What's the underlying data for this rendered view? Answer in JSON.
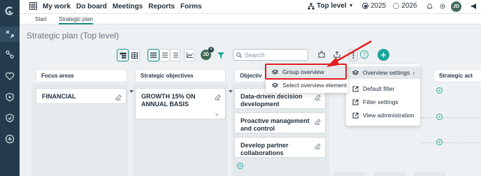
{
  "topnav": {
    "items": [
      "My work",
      "Do board",
      "Meetings",
      "Reports",
      "Forms"
    ],
    "level": "Top level",
    "years": [
      {
        "label": "2025",
        "selected": true
      },
      {
        "label": "2026",
        "selected": false
      }
    ],
    "avatar_initials": "JD"
  },
  "tabs": [
    "Start",
    "Strategic plan"
  ],
  "page": {
    "title": "Strategic plan (Top level)"
  },
  "toolbar": {
    "search_placeholder": "Search",
    "avatar_initials": "JD",
    "avatar_badge": "4",
    "help": "?",
    "add": "+"
  },
  "columns": {
    "focus_areas": "Focus areas",
    "strategic_objectives": "Strategic objectives",
    "objectives": "Objectiv",
    "strategic_act": "Strategic act"
  },
  "cards": {
    "focus": "FINANCIAL",
    "strategic": "GROWTH 15% ON ANNUAL BASIS",
    "obj1": "Data-driven decision development",
    "obj2": "Proactive management and control",
    "obj3": "Develop partner collaborations"
  },
  "menu_main": {
    "items": [
      "Overview settings",
      "Default filter",
      "Filter settings",
      "View administration"
    ]
  },
  "menu_sub": {
    "items": [
      "Group overview",
      "Select overview element"
    ]
  },
  "colors": {
    "rail": "#243c4c",
    "accent": "#1aa59a",
    "highlight": "#e02020"
  }
}
